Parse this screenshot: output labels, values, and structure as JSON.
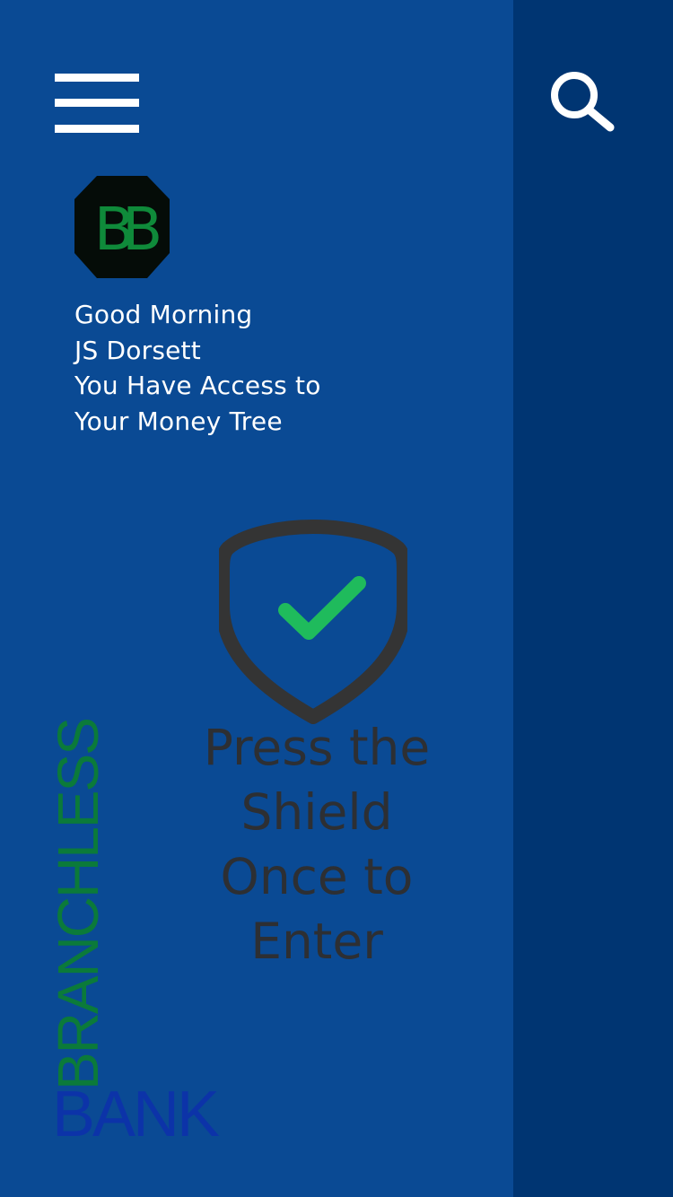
{
  "colors": {
    "main_background": "#0a4a94",
    "side_background": "#003572",
    "icon_white": "#ffffff",
    "shield_stroke": "#343434",
    "check_green": "#1fbb5c",
    "prompt_text": "#2d2f33",
    "brand_green": "#0b7a3a",
    "brand_blue": "#0c33a8",
    "logo_fill": "#050c08",
    "logo_letters": "#0f8a3a"
  },
  "header": {
    "menu_icon": "hamburger-menu-icon",
    "search_icon": "search-icon"
  },
  "logo": {
    "letters": "BB"
  },
  "greeting": {
    "line1": "Good Morning",
    "line2": "JS Dorsett",
    "line3": "You Have Access to",
    "line4": "Your Money Tree"
  },
  "shield": {
    "icon": "shield-check-icon"
  },
  "prompt": {
    "line1": "Press the",
    "line2": "Shield",
    "line3": "Once to",
    "line4": "Enter"
  },
  "brand": {
    "vertical_word": "BRANCHLESS",
    "bottom_word": "BANK"
  }
}
